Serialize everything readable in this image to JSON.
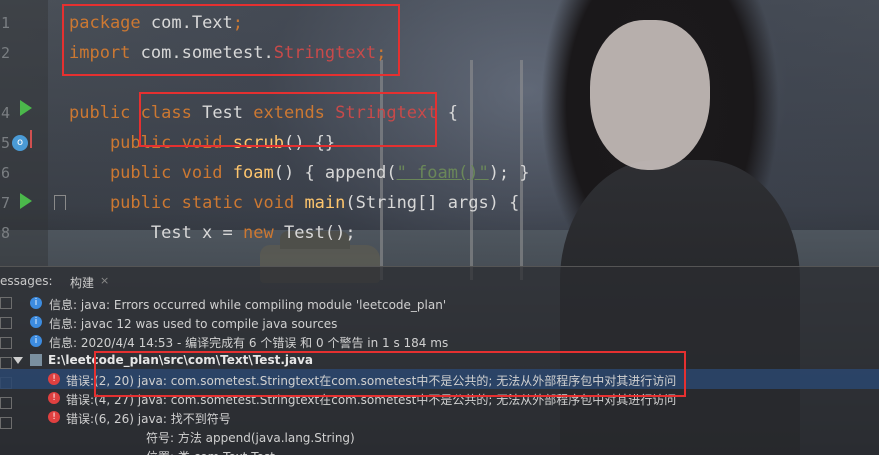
{
  "editor": {
    "line_numbers": [
      "1",
      "2",
      "",
      "4",
      "5",
      "6",
      "7",
      "8"
    ],
    "lines": [
      {
        "parts": [
          {
            "t": "package ",
            "c": "kw"
          },
          {
            "t": "com.Text",
            "c": "cls"
          },
          {
            "t": ";",
            "c": "kw"
          }
        ]
      },
      {
        "parts": [
          {
            "t": "import ",
            "c": "kw"
          },
          {
            "t": "com.sometest.",
            "c": "cls"
          },
          {
            "t": "Stringtext",
            "c": "err"
          },
          {
            "t": ";",
            "c": "kw"
          }
        ]
      },
      {
        "parts": []
      },
      {
        "parts": [
          {
            "t": "public ",
            "c": "kw"
          },
          {
            "t": "class ",
            "c": "kw"
          },
          {
            "t": "Test ",
            "c": "cls"
          },
          {
            "t": "extends ",
            "c": "kw"
          },
          {
            "t": "Stringtext",
            "c": "err"
          },
          {
            "t": " {",
            "c": "cls"
          }
        ]
      },
      {
        "parts": [
          {
            "t": "    public ",
            "c": "kw"
          },
          {
            "t": "void ",
            "c": "kw"
          },
          {
            "t": "scrub",
            "c": "fn"
          },
          {
            "t": "() {}",
            "c": "cls"
          }
        ]
      },
      {
        "parts": [
          {
            "t": "    public ",
            "c": "kw"
          },
          {
            "t": "void ",
            "c": "kw"
          },
          {
            "t": "foam",
            "c": "fn"
          },
          {
            "t": "() { append(",
            "c": "cls"
          },
          {
            "t": "\" foam()\"",
            "c": "str"
          },
          {
            "t": "); }",
            "c": "cls"
          }
        ]
      },
      {
        "parts": [
          {
            "t": "    public ",
            "c": "kw"
          },
          {
            "t": "static ",
            "c": "kw"
          },
          {
            "t": "void ",
            "c": "kw"
          },
          {
            "t": "main",
            "c": "fn"
          },
          {
            "t": "(String[] args) {",
            "c": "cls"
          }
        ]
      },
      {
        "parts": [
          {
            "t": "        Test x = ",
            "c": "cls"
          },
          {
            "t": "new ",
            "c": "kw"
          },
          {
            "t": "Test();",
            "c": "cls"
          }
        ]
      }
    ]
  },
  "panel": {
    "tab_prefix": "essages:",
    "tab_build": "构建",
    "tab_close": "×",
    "messages": [
      {
        "kind": "info",
        "text": "信息: java: Errors occurred while compiling module 'leetcode_plan'"
      },
      {
        "kind": "info",
        "text": "信息: javac 12 was used to compile java sources"
      },
      {
        "kind": "info",
        "text": "信息: 2020/4/4 14:53 - 编译完成有 6 个错误 和 0 个警告 in 1 s 184 ms"
      },
      {
        "kind": "file",
        "text": "E:\\leetcode_plan\\src\\com\\Text\\Test.java"
      },
      {
        "kind": "error",
        "text": "错误:(2, 20)  java: com.sometest.Stringtext在com.sometest中不是公共的; 无法从外部程序包中对其进行访问",
        "selected": true
      },
      {
        "kind": "error",
        "text": "错误:(4, 27)  java: com.sometest.Stringtext在com.sometest中不是公共的; 无法从外部程序包中对其进行访问"
      },
      {
        "kind": "error",
        "text": "错误:(6, 26)  java: 找不到符号"
      },
      {
        "kind": "detail",
        "text": "符号:   方法 append(java.lang.String)"
      },
      {
        "kind": "detail",
        "text": "位置: 类 com.Text.Test"
      }
    ]
  }
}
